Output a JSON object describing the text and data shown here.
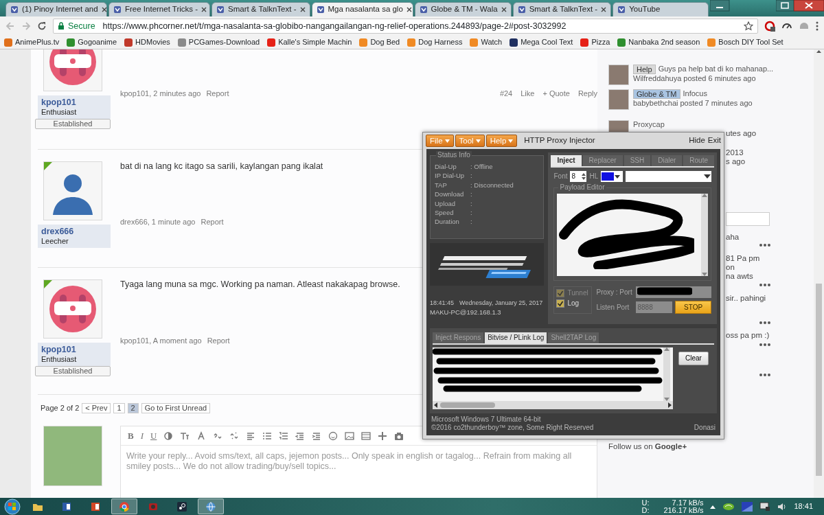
{
  "browser_tabs": [
    {
      "title": "(1) Pinoy Internet and",
      "selected": false,
      "closable": true
    },
    {
      "title": "Free Internet Tricks -",
      "selected": false,
      "closable": true
    },
    {
      "title": "Smart & TalknText -",
      "selected": false,
      "closable": true
    },
    {
      "title": "Mga nasalanta sa glo",
      "selected": true,
      "closable": true
    },
    {
      "title": "Globe & TM - Wala",
      "selected": false,
      "closable": true
    },
    {
      "title": "Smart & TalknText -",
      "selected": false,
      "closable": true
    },
    {
      "title": "YouTube",
      "selected": false,
      "closable": false
    }
  ],
  "address_bar": {
    "secure_label": "Secure",
    "url": "https://www.phcorner.net/t/mga-nasalanta-sa-globibo-nangangailangan-ng-relief-operations.244893/page-2#post-3032992"
  },
  "bookmarks": [
    {
      "label": "AnimePlus.tv",
      "color": "#e0701c"
    },
    {
      "label": "Gogoanime",
      "color": "#2f8f2f"
    },
    {
      "label": "HDMovies",
      "color": "#c0392b"
    },
    {
      "label": "PCGames-Download",
      "color": "#8a8a8a"
    },
    {
      "label": "Kalle's Simple Machin",
      "color": "#e62117"
    },
    {
      "label": "Dog Bed",
      "color": "#f08a24"
    },
    {
      "label": "Dog Harness",
      "color": "#f08a24"
    },
    {
      "label": "Watch",
      "color": "#f08a24"
    },
    {
      "label": "Mega Cool Text",
      "color": "#1f2f5f"
    },
    {
      "label": "Pizza",
      "color": "#e62117"
    },
    {
      "label": "Nanbaka 2nd season",
      "color": "#2f8f2f"
    },
    {
      "label": "Bosch DIY Tool Set",
      "color": "#f08a24"
    }
  ],
  "posts": [
    {
      "user": "kpop101",
      "rank": "Enthusiast",
      "badge": "Established",
      "avatar": {
        "kind": "pop"
      },
      "online": false,
      "meta": "kpop101, 2 minutes ago",
      "report": "Report",
      "actions": [
        "#24",
        "Like",
        "+ Quote",
        "Reply"
      ]
    },
    {
      "user": "drex666",
      "rank": "Leecher",
      "avatar": {
        "kind": "silhouette"
      },
      "online": true,
      "body": "bat di na lang kc itago sa sarili, kaylangan pang ikalat",
      "meta": "drex666, 1 minute ago",
      "report": "Report"
    },
    {
      "user": "kpop101",
      "rank": "Enthusiast",
      "badge": "Established",
      "avatar": {
        "kind": "pop"
      },
      "online": true,
      "body": "Tyaga lang muna sa mgc. Working pa naman. Atleast nakakapag browse.",
      "meta": "kpop101, A moment ago",
      "report": "Report"
    }
  ],
  "pagination": {
    "label": "Page 2 of 2",
    "prev": "< Prev",
    "pages": [
      {
        "label": "1",
        "selected": false
      },
      {
        "label": "2",
        "selected": true
      }
    ],
    "first_unread": "Go to First Unread"
  },
  "editor": {
    "format_buttons": [
      "B",
      "I",
      "U"
    ],
    "placeholder": "Write your reply... Avoid sms/text, all caps, jejemon posts... Only speak in english or tagalog... Refrain from making all smiley posts... We do not allow trading/buy/sell topics..."
  },
  "sidebar": {
    "threads": [
      {
        "tag": {
          "label": "Help",
          "color": "#d9d9d9"
        },
        "title": "Guys pa help bat di ko mahanap...",
        "meta": "Wilfreddahuya posted 6 minutes ago"
      },
      {
        "tag": {
          "label": "Globe & TM",
          "color": "#a9c4e2"
        },
        "title": "Infocus",
        "meta": "babybethchai posted 7 minutes ago"
      },
      {
        "title": "Proxycap"
      }
    ],
    "fragments": [
      {
        "kind": "text",
        "text": "utes ago"
      },
      {
        "kind": "text",
        "text": "2013"
      },
      {
        "kind": "text",
        "text": "s ago"
      },
      {
        "kind": "field"
      },
      {
        "kind": "text",
        "text": "aha"
      },
      {
        "kind": "dots"
      },
      {
        "kind": "text",
        "text": "81 Pa pm"
      },
      {
        "kind": "text",
        "text": "on"
      },
      {
        "kind": "text",
        "text": "na awts"
      },
      {
        "kind": "dots"
      },
      {
        "kind": "text",
        "text": "sir.. pahingi"
      },
      {
        "kind": "dots"
      },
      {
        "kind": "text",
        "text": "oss pa pm :)"
      },
      {
        "kind": "dots"
      },
      {
        "kind": "dots"
      }
    ],
    "follow": "Follow us on **Google+**"
  },
  "injector": {
    "menus": [
      "File",
      "Tool",
      "Help"
    ],
    "title": "HTTP Proxy Injector",
    "window_buttons": [
      "Hide",
      "Exit"
    ],
    "status_title": "Status Info",
    "status": [
      {
        "label": "Dial-Up",
        "value": ":  Offline"
      },
      {
        "label": "IP Dial-Up",
        "value": ":"
      },
      {
        "label": "TAP",
        "value": ":  Disconnected"
      },
      {
        "label": "Download",
        "value": ":"
      },
      {
        "label": "Upload",
        "value": ":"
      },
      {
        "label": "Speed",
        "value": ":"
      },
      {
        "label": "Duration",
        "value": ":"
      }
    ],
    "time": "18:41:45",
    "date": "Wednesday, January 25, 2017",
    "host": "MAKU-PC@192.168.1.3",
    "tabs": [
      {
        "label": "Inject",
        "selected": true
      },
      {
        "label": "Replacer",
        "selected": false
      },
      {
        "label": "SSH",
        "selected": false
      },
      {
        "label": "Dialer",
        "selected": false
      },
      {
        "label": "Route",
        "selected": false
      }
    ],
    "font_label": "Font",
    "font_value": "8",
    "highlight": {
      "label": "HL",
      "color": "#1010e0"
    },
    "payload_title": "Payload Editor",
    "options": [
      {
        "label": "Tunnel",
        "checked": true,
        "disabled": true
      },
      {
        "label": "Log",
        "checked": true,
        "disabled": false
      }
    ],
    "proxy_label": "Proxy : Port",
    "listen_label": "Listen Port",
    "listen_value": "8888",
    "stop": "STOP",
    "log_tabs": [
      {
        "label": "Inject Respons",
        "selected": false
      },
      {
        "label": "Bitvise / PLink Log",
        "selected": true
      },
      {
        "label": "Shell2TAP Log",
        "selected": false
      }
    ],
    "clear": "Clear",
    "footer": [
      "Microsoft Windows 7 Ultimate  64-bit",
      "©2016 co2thunderboy™ zone, Some Right Reserved"
    ],
    "donate": "Donasi"
  },
  "taskbar": {
    "apps": [
      {
        "kind": "folder",
        "active": false
      },
      {
        "kind": "word",
        "active": false
      },
      {
        "kind": "powerpoint",
        "active": false
      },
      {
        "kind": "chrome",
        "active": true
      },
      {
        "kind": "redapp",
        "active": false
      },
      {
        "kind": "steam",
        "active": false
      },
      {
        "kind": "injector",
        "active": true
      }
    ],
    "upload_label": "U:",
    "upload": "7.17 kB/s",
    "download_label": "D:",
    "download": "216.17 kB/s",
    "time": "18:41"
  }
}
